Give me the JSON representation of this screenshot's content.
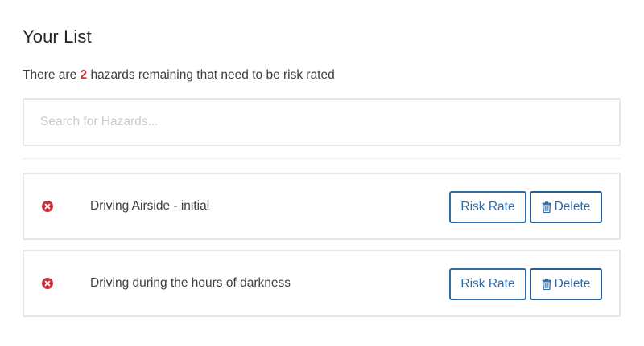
{
  "page": {
    "title": "Your List",
    "summary_prefix": "There are ",
    "summary_count": "2",
    "summary_suffix": " hazards remaining that need to be risk rated"
  },
  "search": {
    "placeholder": "Search for Hazards...",
    "value": ""
  },
  "hazards": [
    {
      "name": "Driving Airside - initial",
      "status_icon": "error-circle-icon",
      "risk_rate_label": "Risk Rate",
      "delete_label": "Delete"
    },
    {
      "name": "Driving during the hours of darkness",
      "status_icon": "error-circle-icon",
      "risk_rate_label": "Risk Rate",
      "delete_label": "Delete"
    }
  ],
  "colors": {
    "accent": "#2f6da8",
    "danger": "#c8303a",
    "border": "#e4e6e8"
  }
}
